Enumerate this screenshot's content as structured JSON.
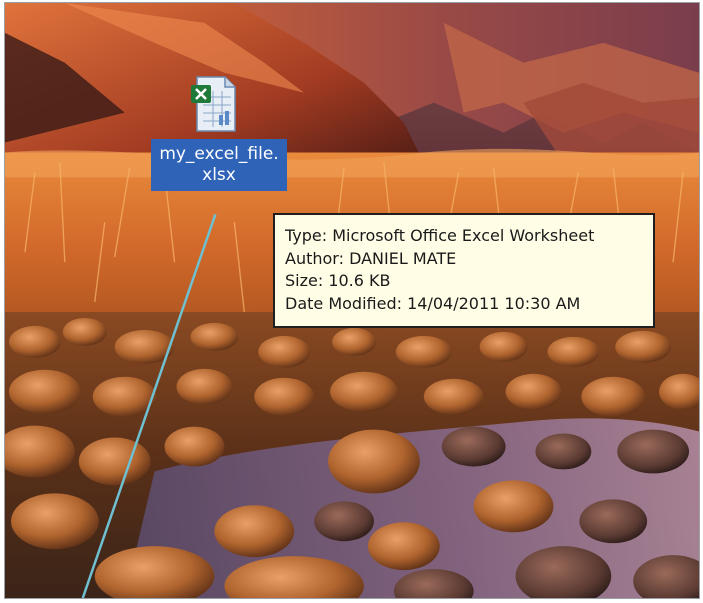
{
  "desktop": {
    "file": {
      "name": "my_excel_file.xlsx",
      "icon": "excel-file-icon",
      "selected": true
    },
    "tooltip": {
      "type_line": "Type: Microsoft Office Excel Worksheet",
      "author_line": "Author: DANIEL MATE",
      "size_line": "Size: 10.6 KB",
      "modified_line": "Date Modified: 14/04/2011 10:30 AM"
    }
  },
  "colors": {
    "selection": "#2f63b8",
    "tooltip_background": "#fffde6",
    "connector_line": "#6fc0d0",
    "excel_green": "#1f7a3a"
  }
}
